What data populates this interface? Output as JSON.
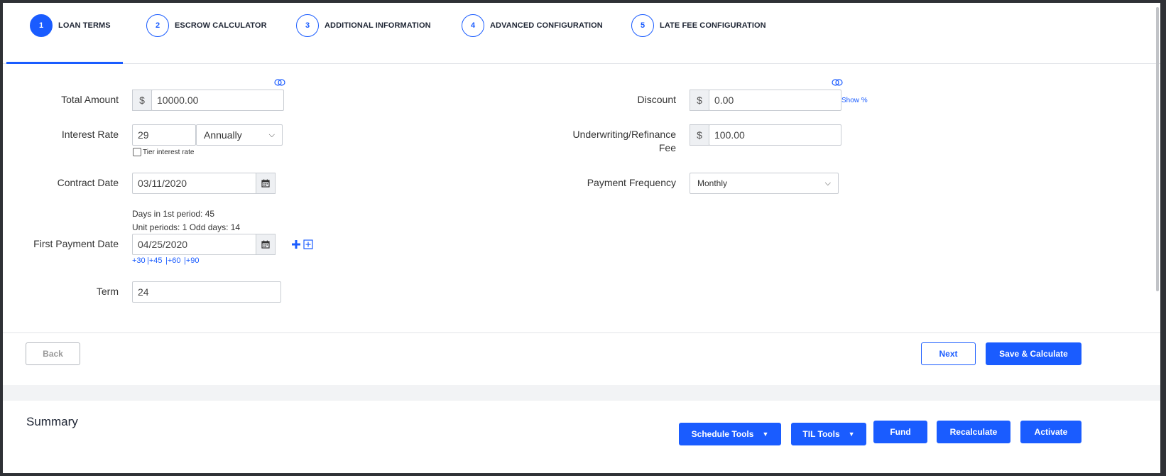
{
  "steps": [
    {
      "num": "1",
      "label": "LOAN TERMS"
    },
    {
      "num": "2",
      "label": "ESCROW CALCULATOR"
    },
    {
      "num": "3",
      "label": "ADDITIONAL INFORMATION"
    },
    {
      "num": "4",
      "label": "ADVANCED CONFIGURATION"
    },
    {
      "num": "5",
      "label": "LATE FEE CONFIGURATION"
    }
  ],
  "form": {
    "total_amount": {
      "label": "Total Amount",
      "prefix": "$",
      "value": "10000.00"
    },
    "interest_rate": {
      "label": "Interest Rate",
      "value": "29",
      "period": "Annually",
      "tier_label": "Tier interest rate"
    },
    "contract_date": {
      "label": "Contract Date",
      "value": "03/11/2020"
    },
    "period_info": {
      "days_first": "Days in 1st period: 45",
      "unit_periods": "Unit periods: 1 Odd days: 14"
    },
    "first_payment_date": {
      "label": "First Payment Date",
      "value": "04/25/2020",
      "quick_links": [
        "+30",
        "|+45",
        "|+60",
        "|+90"
      ]
    },
    "term": {
      "label": "Term",
      "value": "24"
    },
    "discount": {
      "label": "Discount",
      "prefix": "$",
      "value": "0.00",
      "show_pct": "Show %"
    },
    "underwriting_fee": {
      "label_line1": "Underwriting/Refinance",
      "label_line2": "Fee",
      "prefix": "$",
      "value": "100.00"
    },
    "payment_frequency": {
      "label": "Payment Frequency",
      "value": "Monthly"
    }
  },
  "nav": {
    "back": "Back",
    "next": "Next",
    "save_calc": "Save & Calculate"
  },
  "summary": {
    "title": "Summary",
    "schedule_tools": "Schedule Tools",
    "til_tools": "TIL Tools",
    "fund": "Fund",
    "recalculate": "Recalculate",
    "activate": "Activate"
  },
  "colors": {
    "accent": "#1a5cff"
  }
}
